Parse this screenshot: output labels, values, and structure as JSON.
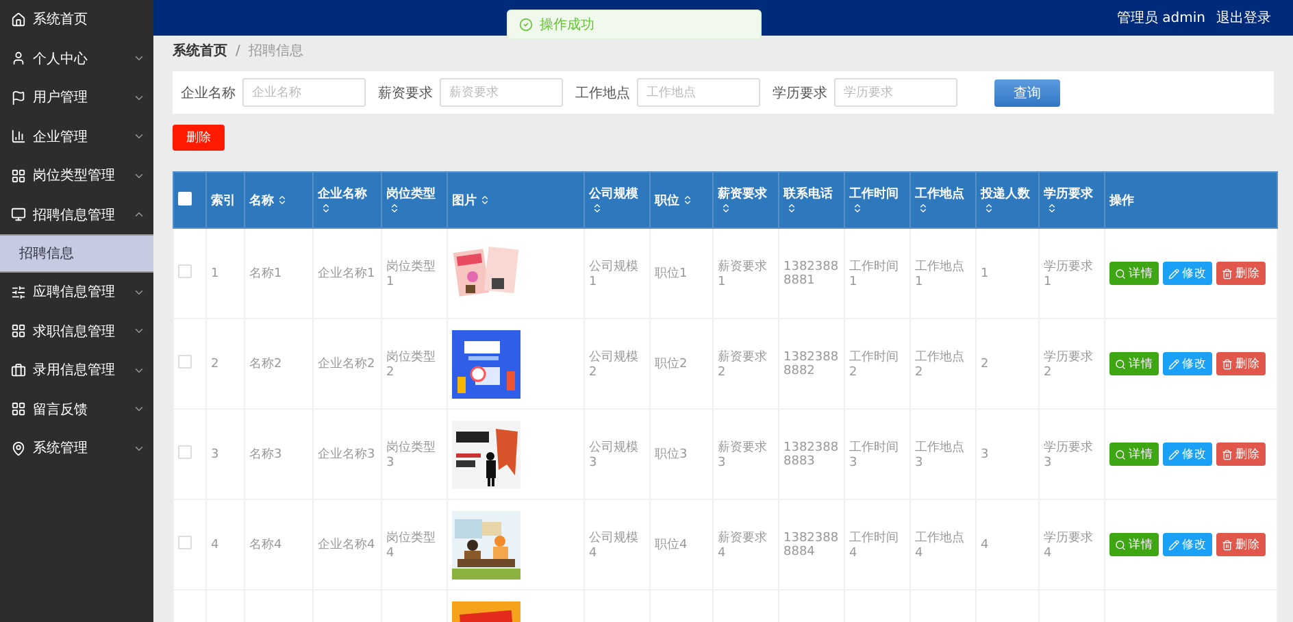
{
  "topbar": {
    "user": "管理员 admin",
    "logout": "退出登录"
  },
  "toast": {
    "message": "操作成功"
  },
  "sidebar": {
    "items": [
      {
        "label": "系统首页",
        "kind": "link"
      },
      {
        "label": "个人中心",
        "kind": "menu",
        "expanded": false
      },
      {
        "label": "用户管理",
        "kind": "menu",
        "expanded": false
      },
      {
        "label": "企业管理",
        "kind": "menu",
        "expanded": false
      },
      {
        "label": "岗位类型管理",
        "kind": "menu",
        "expanded": false
      },
      {
        "label": "招聘信息管理",
        "kind": "menu",
        "expanded": true,
        "children": [
          {
            "label": "招聘信息",
            "selected": true
          }
        ]
      },
      {
        "label": "应聘信息管理",
        "kind": "menu",
        "expanded": false
      },
      {
        "label": "求职信息管理",
        "kind": "menu",
        "expanded": false
      },
      {
        "label": "录用信息管理",
        "kind": "menu",
        "expanded": false
      },
      {
        "label": "留言反馈",
        "kind": "menu",
        "expanded": false
      },
      {
        "label": "系统管理",
        "kind": "menu",
        "expanded": false
      }
    ]
  },
  "breadcrumb": {
    "items": [
      "系统首页",
      "招聘信息"
    ],
    "separator": "/"
  },
  "search": {
    "fields": [
      {
        "label": "企业名称",
        "placeholder": "企业名称"
      },
      {
        "label": "薪资要求",
        "placeholder": "薪资要求"
      },
      {
        "label": "工作地点",
        "placeholder": "工作地点"
      },
      {
        "label": "学历要求",
        "placeholder": "学历要求"
      }
    ],
    "button": "查询"
  },
  "delete_button": "删除",
  "table": {
    "select_all": {
      "checked": false
    },
    "columns": [
      {
        "label": "索引",
        "sortable": false
      },
      {
        "label": "名称",
        "sortable": true
      },
      {
        "label": "企业名称",
        "sortable": true
      },
      {
        "label": "岗位类型",
        "sortable": true
      },
      {
        "label": "图片",
        "sortable": true
      },
      {
        "label": "公司规模",
        "sortable": true
      },
      {
        "label": "职位",
        "sortable": true
      },
      {
        "label": "薪资要求",
        "sortable": true
      },
      {
        "label": "联系电话",
        "sortable": true
      },
      {
        "label": "工作时间",
        "sortable": true
      },
      {
        "label": "工作地点",
        "sortable": true
      },
      {
        "label": "投递人数",
        "sortable": true
      },
      {
        "label": "学历要求",
        "sortable": true
      },
      {
        "label": "操作",
        "sortable": false
      }
    ],
    "rows": [
      {
        "checked": false,
        "cells": [
          "1",
          "名称1",
          "企业名称1",
          "岗位类型1",
          null,
          "公司规模1",
          "职位1",
          "薪资要求1",
          "13823888881",
          "工作时间1",
          "工作地点1",
          "1",
          "学历要求1"
        ],
        "actions": [
          "详情",
          "修改",
          "删除"
        ],
        "picture": {
          "kind": "picture"
        }
      },
      {
        "checked": false,
        "cells": [
          "2",
          "名称2",
          "企业名称2",
          "岗位类型2",
          null,
          "公司规模2",
          "职位2",
          "薪资要求2",
          "13823888882",
          "工作时间2",
          "工作地点2",
          "2",
          "学历要求2"
        ],
        "actions": [
          "详情",
          "修改",
          "删除"
        ],
        "picture": {
          "kind": "picture"
        }
      },
      {
        "checked": false,
        "cells": [
          "3",
          "名称3",
          "企业名称3",
          "岗位类型3",
          null,
          "公司规模3",
          "职位3",
          "薪资要求3",
          "13823888883",
          "工作时间3",
          "工作地点3",
          "3",
          "学历要求3"
        ],
        "actions": [
          "详情",
          "修改",
          "删除"
        ],
        "picture": {
          "kind": "picture"
        }
      },
      {
        "checked": false,
        "cells": [
          "4",
          "名称4",
          "企业名称4",
          "岗位类型4",
          null,
          "公司规模4",
          "职位4",
          "薪资要求4",
          "13823888884",
          "工作时间4",
          "工作地点4",
          "4",
          "学历要求4"
        ],
        "actions": [
          "详情",
          "修改",
          "删除"
        ],
        "picture": {
          "kind": "picture"
        }
      },
      {
        "picture": {
          "kind": "picture"
        }
      }
    ]
  }
}
